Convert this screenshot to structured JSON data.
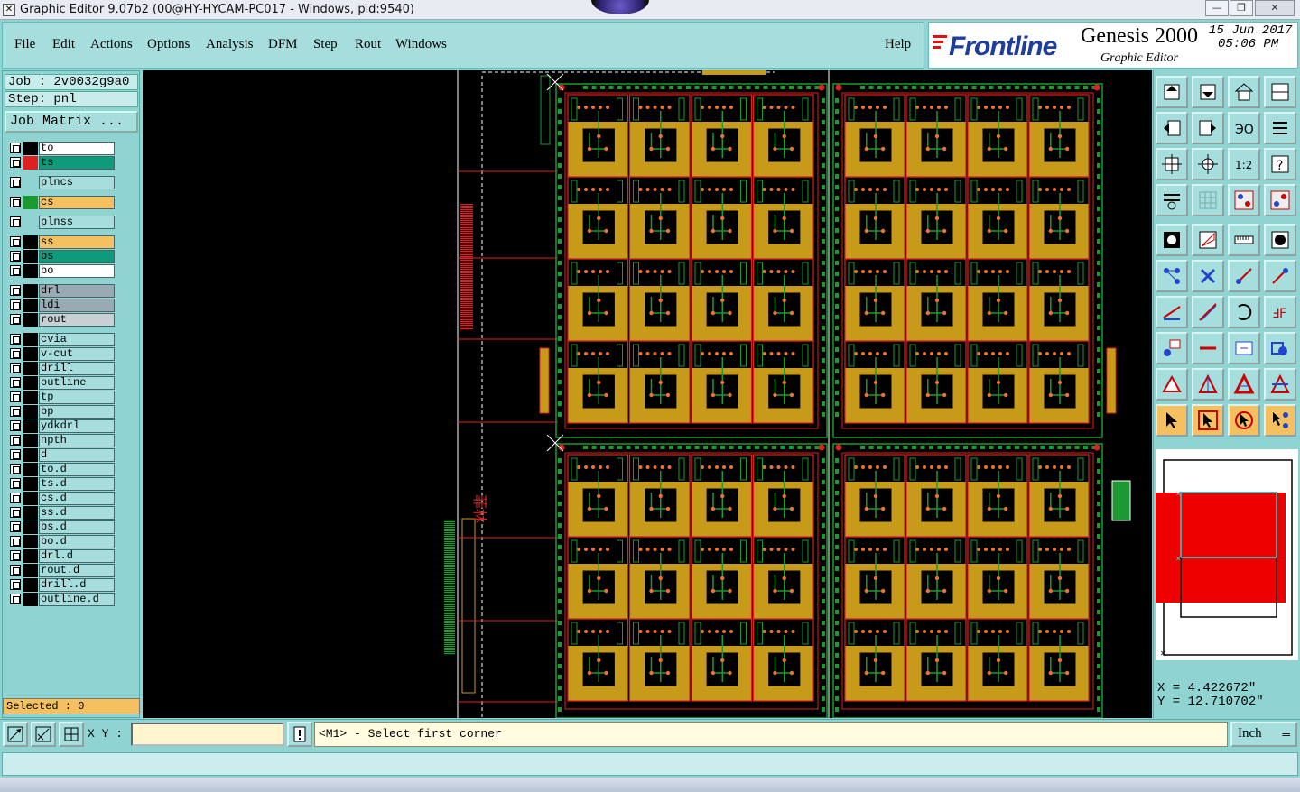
{
  "window": {
    "title": "Graphic Editor 9.07b2 (00@HY-HYCAM-PC017 - Windows, pid:9540)",
    "minimize": "—",
    "maximize": "❐",
    "close": "✕"
  },
  "menu": [
    {
      "label": "File"
    },
    {
      "label": "Edit"
    },
    {
      "label": "Actions"
    },
    {
      "label": "Options"
    },
    {
      "label": "Analysis"
    },
    {
      "label": "DFM"
    },
    {
      "label": "Step"
    },
    {
      "label": "Rout"
    },
    {
      "label": "Windows"
    }
  ],
  "help_label": "Help",
  "brand": {
    "logo": "Frontline",
    "product": "Genesis 2000",
    "subtitle": "Graphic Editor",
    "date": "15 Jun 2017",
    "time": "05:06 PM"
  },
  "job": {
    "job_line": "Job : 2v0032g9a0",
    "step_line": "Step: pnl",
    "matrix_button": "Job Matrix ..."
  },
  "layers": [
    {
      "name": "to",
      "bg": "#ffffff",
      "swatch": "#000000"
    },
    {
      "name": "ts",
      "bg": "#0f9a7a",
      "swatch": "#e02020",
      "work": true
    },
    {
      "name": "plncs",
      "bg": "#a6dede",
      "swatch": "#8fd3d3"
    },
    {
      "name": "cs",
      "bg": "#f4c060",
      "swatch": "#1a9a30"
    },
    {
      "name": "plnss",
      "bg": "#a6dede",
      "swatch": "#8fd3d3"
    },
    {
      "name": "ss",
      "bg": "#f4c060",
      "swatch": "#000000"
    },
    {
      "name": "bs",
      "bg": "#0f9a7a",
      "swatch": "#000000"
    },
    {
      "name": "bo",
      "bg": "#ffffff",
      "swatch": "#000000"
    },
    {
      "name": "drl",
      "bg": "#9aaab4",
      "swatch": "#000000"
    },
    {
      "name": "ldi",
      "bg": "#9aaab4",
      "swatch": "#000000"
    },
    {
      "name": "rout",
      "bg": "#c8d0d4",
      "swatch": "#000000"
    },
    {
      "name": "cvia",
      "bg": "#a6dede",
      "swatch": "#000000"
    },
    {
      "name": "v-cut",
      "bg": "#a6dede",
      "swatch": "#000000"
    },
    {
      "name": "drill",
      "bg": "#a6dede",
      "swatch": "#000000"
    },
    {
      "name": "outline",
      "bg": "#a6dede",
      "swatch": "#000000"
    },
    {
      "name": "tp",
      "bg": "#a6dede",
      "swatch": "#000000"
    },
    {
      "name": "bp",
      "bg": "#a6dede",
      "swatch": "#000000"
    },
    {
      "name": "ydkdrl",
      "bg": "#a6dede",
      "swatch": "#000000"
    },
    {
      "name": "npth",
      "bg": "#a6dede",
      "swatch": "#000000"
    },
    {
      "name": "d",
      "bg": "#a6dede",
      "swatch": "#000000"
    },
    {
      "name": "to.d",
      "bg": "#a6dede",
      "swatch": "#000000"
    },
    {
      "name": "ts.d",
      "bg": "#a6dede",
      "swatch": "#000000"
    },
    {
      "name": "cs.d",
      "bg": "#a6dede",
      "swatch": "#000000"
    },
    {
      "name": "ss.d",
      "bg": "#a6dede",
      "swatch": "#000000"
    },
    {
      "name": "bs.d",
      "bg": "#a6dede",
      "swatch": "#000000"
    },
    {
      "name": "bo.d",
      "bg": "#a6dede",
      "swatch": "#000000"
    },
    {
      "name": "drl.d",
      "bg": "#a6dede",
      "swatch": "#000000"
    },
    {
      "name": "rout.d",
      "bg": "#a6dede",
      "swatch": "#000000"
    },
    {
      "name": "drill.d",
      "bg": "#a6dede",
      "swatch": "#000000"
    },
    {
      "name": "outline.d",
      "bg": "#a6dede",
      "swatch": "#000000"
    }
  ],
  "selected": "Selected : 0",
  "canvas": {
    "side_label_cn": "菲林",
    "colors": {
      "background": "#000000",
      "copper": "#c89a1a",
      "outline": "#e02020",
      "trace": "#1a9a30",
      "pad": "#f07030"
    }
  },
  "toolbar_icons": [
    "home-icon",
    "pan-down-icon",
    "house-icon",
    "window-split-icon",
    "zoom-back-icon",
    "zoom-forward-icon",
    "step-back-icon",
    "snap-icon",
    "fit-view-icon",
    "zoom-center-icon",
    "ratio-icon",
    "help-icon",
    "tool-settings-icon",
    "grid-icon",
    "layer-palette-icon",
    "layer-palette-alt-icon",
    "camera-icon",
    "edit-shape-icon",
    "ruler-icon",
    "circle-pad-icon",
    "net-nodes-icon",
    "cross-select-icon",
    "line-node-icon",
    "line-node-alt-icon",
    "draw-line-icon",
    "draw-diagonal-icon",
    "arc-icon",
    "text-icon",
    "zoom-box-icon",
    "horizontal-line-icon",
    "measure-box-icon",
    "shapes-icon",
    "triangle-icon",
    "triangle-up-icon",
    "triangle-fill-icon",
    "triangle-cut-icon",
    "pointer-icon",
    "select-pointer-icon",
    "rotate-select-icon",
    "multi-select-icon"
  ],
  "coords": {
    "x_line": "X = 4.422672\"",
    "y_line": "Y = 12.710702\""
  },
  "status": {
    "xy_label": "X Y :",
    "xy_value": "",
    "prompt": "<M1> - Select first corner",
    "units": "Inch"
  }
}
